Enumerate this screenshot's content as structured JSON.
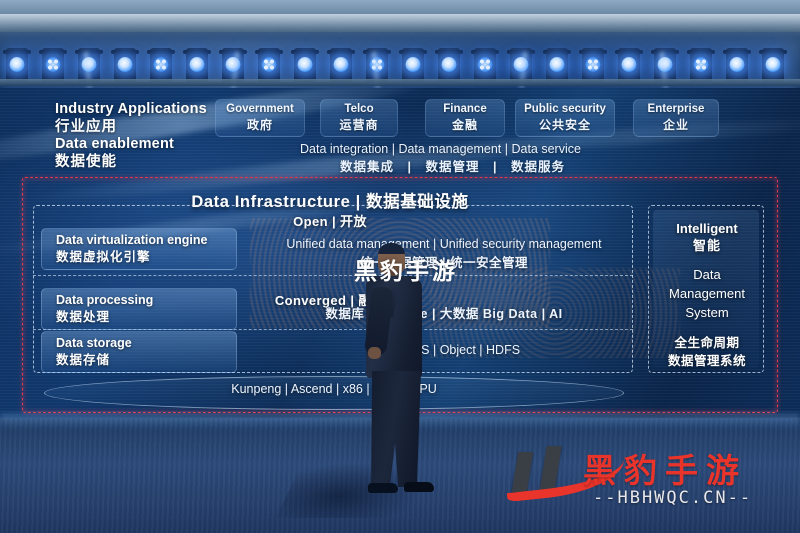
{
  "scene": {
    "venue": "conference-stage",
    "watermark_center": "黑豹手游",
    "watermark_brand_cn": "黑豹手游",
    "watermark_url": "--HBHWQC.CN--",
    "accent_red": "#e8342a",
    "frame_red": "#e2384e",
    "screen_blue": "#0d2f5e"
  },
  "slide": {
    "header": {
      "left_lines": [
        "Industry Applications",
        "行业应用",
        "Data enablement",
        "数据使能"
      ],
      "industries": [
        {
          "en": "Government",
          "cn": "政府"
        },
        {
          "en": "Telco",
          "cn": "运营商"
        },
        {
          "en": "Finance",
          "cn": "金融"
        },
        {
          "en": "Public security",
          "cn": "公共安全"
        },
        {
          "en": "Enterprise",
          "cn": "企业"
        }
      ],
      "enablement_en": "Data integration | Data management | Data service",
      "enablement_cn": "数据集成　|　数据管理　|　数据服务"
    },
    "infrastructure": {
      "title": "Data Infrastructure | 数据基础设施",
      "bands": [
        {
          "label": "Open | 开放"
        },
        {
          "label": "Converged | 融合"
        }
      ],
      "rows": [
        {
          "tag_en": "Data virtualization engine",
          "tag_cn": "数据虚拟化引擎",
          "content_en": "Unified data management | Unified security management",
          "content_cn": "统一数据管理 | 统一安全管理"
        },
        {
          "tag_en": "Data processing",
          "tag_cn": "数据处理",
          "content_en": "",
          "content_cn": "数据库 Database | 大数据 Big Data | AI"
        },
        {
          "tag_en": "Data storage",
          "tag_cn": "数据存储",
          "content_en": "SAN | NAS | Object | HDFS",
          "content_cn": ""
        }
      ],
      "hardware": "Kunpeng | Ascend | x86 | NPU | GPU"
    },
    "right_panel": {
      "title_en": "Intelligent",
      "title_cn": "智能",
      "subtitle_en": "Data\nManagement\nSystem",
      "subtitle_en_l1": "Data",
      "subtitle_en_l2": "Management",
      "subtitle_en_l3": "System",
      "desc_cn_l1": "全生命周期",
      "desc_cn_l2": "数据管理系统"
    }
  }
}
